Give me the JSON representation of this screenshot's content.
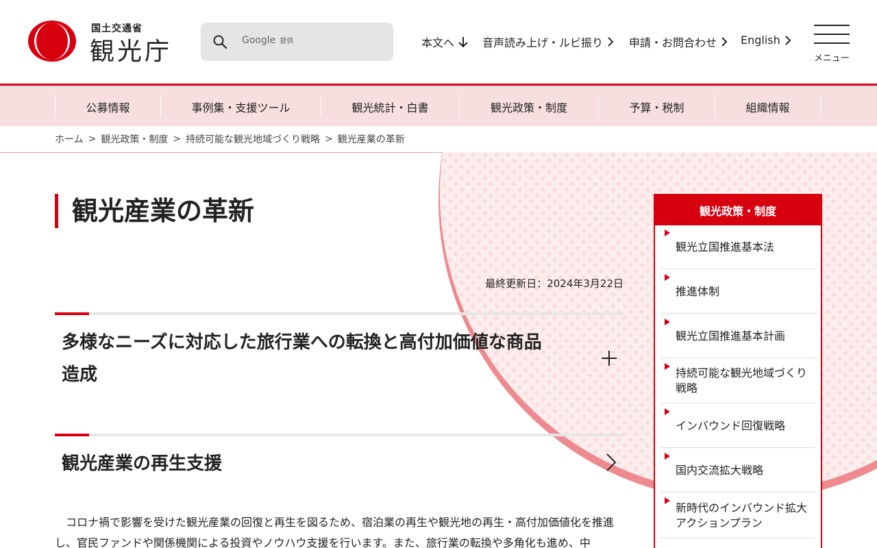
{
  "header": {
    "logo_small": "国土交通省",
    "logo_big": "観光庁",
    "search_placeholder": "Google",
    "search_provider": "提供",
    "util_links": [
      {
        "label": "本文へ"
      },
      {
        "label": "音声読み上げ・ルビ振り"
      },
      {
        "label": "申請・お問合わせ"
      },
      {
        "label": "English"
      }
    ],
    "menu_label": "メニュー"
  },
  "gnav": [
    {
      "label": "公募情報"
    },
    {
      "label": "事例集・支援ツール"
    },
    {
      "label": "観光統計・白書"
    },
    {
      "label": "観光政策・制度"
    },
    {
      "label": "予算・税制"
    },
    {
      "label": "組織情報"
    }
  ],
  "breadcrumb": [
    {
      "label": "ホーム"
    },
    {
      "label": "観光政策・制度"
    },
    {
      "label": "持続可能な観光地域づくり戦略"
    },
    {
      "label": "観光産業の革新"
    }
  ],
  "main": {
    "title": "観光産業の革新",
    "updated": "最終更新日：2024年3月22日",
    "sections": [
      {
        "title_line1": "多様なニーズに対応した旅行業への転換と高付加価値な商品",
        "title_line2": "造成"
      },
      {
        "title_line1": "観光産業の再生支援"
      }
    ],
    "body": "コロナ禍で影響を受けた観光産業の回復と再生を図るため、宿泊業の再生や観光地の再生・高付加価値化を推進し、官民ファンドや関係機関による投資やノウハウ支援を行います。また、旅行業の転換や多角化も進め、中"
  },
  "side": {
    "heading": "観光政策・制度",
    "items": [
      {
        "label": "観光立国推進基本法"
      },
      {
        "label": "推進体制"
      },
      {
        "label": "観光立国推進基本計画"
      },
      {
        "label": "持続可能な観光地域づくり戦略"
      },
      {
        "label": "インバウンド回復戦略"
      },
      {
        "label": "国内交流拡大戦略"
      },
      {
        "label": "新時代のインバウンド拡大アクションプラン"
      }
    ]
  },
  "colors": {
    "accent": "#d7000f",
    "nav_bg": "#f7dfdf",
    "search_bg": "#e5e5e5"
  }
}
